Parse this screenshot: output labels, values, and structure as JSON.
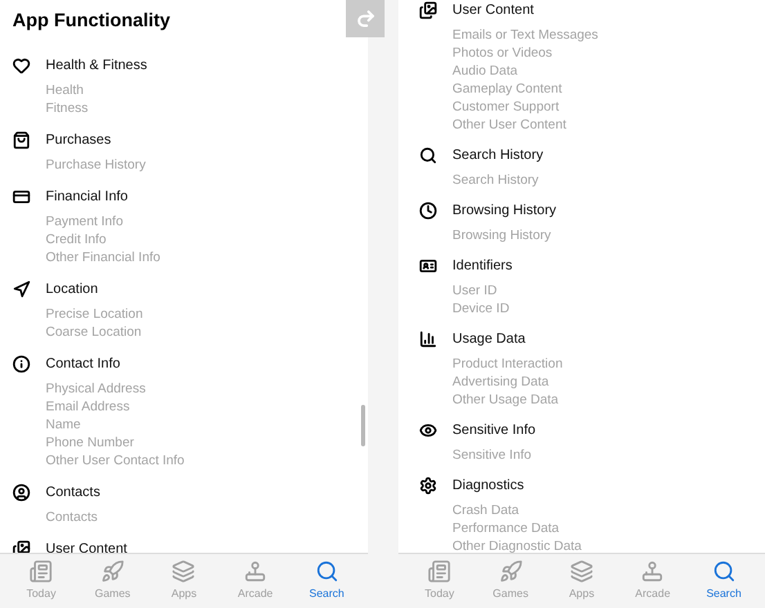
{
  "screens": [
    {
      "title": "App Functionality",
      "sections": [
        {
          "kind": "health",
          "heading": "Health & Fitness",
          "items": [
            "Health",
            "Fitness"
          ]
        },
        {
          "kind": "purchases",
          "heading": "Purchases",
          "items": [
            "Purchase History"
          ]
        },
        {
          "kind": "financial",
          "heading": "Financial Info",
          "items": [
            "Payment Info",
            "Credit Info",
            "Other Financial Info"
          ]
        },
        {
          "kind": "location",
          "heading": "Location",
          "items": [
            "Precise Location",
            "Coarse Location"
          ]
        },
        {
          "kind": "contact",
          "heading": "Contact Info",
          "items": [
            "Physical Address",
            "Email Address",
            "Name",
            "Phone Number",
            "Other User Contact Info"
          ]
        },
        {
          "kind": "contacts",
          "heading": "Contacts",
          "items": [
            "Contacts"
          ]
        },
        {
          "kind": "content",
          "heading": "User Content"
        }
      ],
      "tabs": [
        {
          "label": "Today",
          "kind": "today",
          "selected": false
        },
        {
          "label": "Games",
          "kind": "games",
          "selected": false
        },
        {
          "label": "Apps",
          "kind": "apps",
          "selected": false
        },
        {
          "label": "Arcade",
          "kind": "arcade",
          "selected": false
        },
        {
          "label": "Search",
          "kind": "search",
          "selected": true
        }
      ]
    },
    {
      "sections": [
        {
          "kind": "content",
          "heading": "User Content",
          "items": [
            "Emails or Text Messages",
            "Photos or Videos",
            "Audio Data",
            "Gameplay Content",
            "Customer Support",
            "Other User Content"
          ]
        },
        {
          "kind": "search",
          "heading": "Search History",
          "items": [
            "Search History"
          ]
        },
        {
          "kind": "browsing",
          "heading": "Browsing History",
          "items": [
            "Browsing History"
          ]
        },
        {
          "kind": "identifiers",
          "heading": "Identifiers",
          "items": [
            "User ID",
            "Device ID"
          ]
        },
        {
          "kind": "usage",
          "heading": "Usage Data",
          "items": [
            "Product Interaction",
            "Advertising Data",
            "Other Usage Data"
          ]
        },
        {
          "kind": "sensitive",
          "heading": "Sensitive Info",
          "items": [
            "Sensitive Info"
          ]
        },
        {
          "kind": "diagnostics",
          "heading": "Diagnostics",
          "items": [
            "Crash Data",
            "Performance Data",
            "Other Diagnostic Data"
          ]
        }
      ],
      "tabs": [
        {
          "label": "Today",
          "kind": "today",
          "selected": false
        },
        {
          "label": "Games",
          "kind": "games",
          "selected": false
        },
        {
          "label": "Apps",
          "kind": "apps",
          "selected": false
        },
        {
          "label": "Arcade",
          "kind": "arcade",
          "selected": false
        },
        {
          "label": "Search",
          "kind": "search",
          "selected": true
        }
      ]
    }
  ]
}
